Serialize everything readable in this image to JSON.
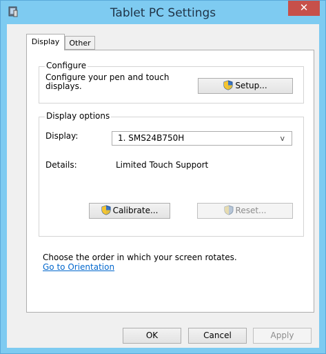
{
  "window": {
    "title": "Tablet PC Settings"
  },
  "tabs": [
    {
      "label": "Display",
      "active": true
    },
    {
      "label": "Other",
      "active": false
    }
  ],
  "configure": {
    "legend": "Configure",
    "text_line1": "Configure your pen and touch",
    "text_line2": "displays.",
    "setup_button": "Setup..."
  },
  "display_options": {
    "legend": "Display options",
    "display_label": "Display:",
    "display_value": "1. SMS24B750H",
    "details_label": "Details:",
    "details_value": "Limited Touch Support",
    "calibrate_button": "Calibrate...",
    "reset_button": "Reset..."
  },
  "orientation": {
    "text": "Choose the order in which your screen rotates.",
    "link": "Go to Orientation"
  },
  "footer": {
    "ok": "OK",
    "cancel": "Cancel",
    "apply": "Apply"
  },
  "colors": {
    "frame": "#7ecbf1",
    "close": "#c7504a",
    "link": "#0066cc"
  }
}
